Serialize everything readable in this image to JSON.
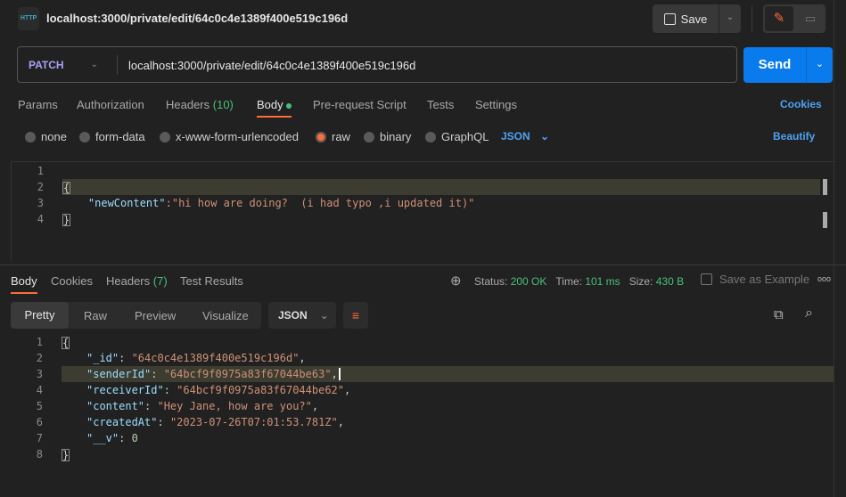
{
  "header": {
    "title": "localhost:3000/private/edit/64c0c4e1389f400e519c196d",
    "save_label": "Save",
    "http_icon_text": "HTTP"
  },
  "request": {
    "method": "PATCH",
    "url": "localhost:3000/private/edit/64c0c4e1389f400e519c196d",
    "send_label": "Send"
  },
  "req_tabs": {
    "params": "Params",
    "authorization": "Authorization",
    "headers": "Headers",
    "headers_count": "(10)",
    "body": "Body",
    "prerequest": "Pre-request Script",
    "tests": "Tests",
    "settings": "Settings",
    "cookies": "Cookies"
  },
  "body_types": {
    "none": "none",
    "form_data": "form-data",
    "urlencoded": "x-www-form-urlencoded",
    "raw": "raw",
    "binary": "binary",
    "graphql": "GraphQL",
    "format": "JSON",
    "beautify": "Beautify",
    "selected": "raw"
  },
  "req_body": {
    "lines": [
      "1",
      "2",
      "3",
      "4"
    ],
    "key": "\"newContent\"",
    "value": "\"hi how are doing?  (i had typo ,i updated it)\""
  },
  "resp_tabs": {
    "body": "Body",
    "cookies": "Cookies",
    "headers": "Headers",
    "headers_count": "(7)",
    "test_results": "Test Results"
  },
  "status": {
    "status_label": "Status:",
    "status": "200 OK",
    "time_label": "Time:",
    "time": "101 ms",
    "size_label": "Size:",
    "size": "430 B",
    "save_example": "Save as Example"
  },
  "view_tabs": {
    "pretty": "Pretty",
    "raw": "Raw",
    "preview": "Preview",
    "visualize": "Visualize",
    "format": "JSON"
  },
  "response": {
    "lines": [
      "1",
      "2",
      "3",
      "4",
      "5",
      "6",
      "7",
      "8"
    ],
    "fields": [
      {
        "key": "\"_id\"",
        "value": "\"64c0c4e1389f400e519c196d\""
      },
      {
        "key": "\"senderId\"",
        "value": "\"64bcf9f0975a83f67044be63\""
      },
      {
        "key": "\"receiverId\"",
        "value": "\"64bcf9f0975a83f67044be62\""
      },
      {
        "key": "\"content\"",
        "value": "\"Hey Jane, how are you?\""
      },
      {
        "key": "\"createdAt\"",
        "value": "\"2023-07-26T07:01:53.781Z\""
      },
      {
        "key": "\"__v\"",
        "value": "0"
      }
    ]
  },
  "colors": {
    "accent": "#ff6c37",
    "send": "#097bed",
    "green": "#49c07a"
  }
}
